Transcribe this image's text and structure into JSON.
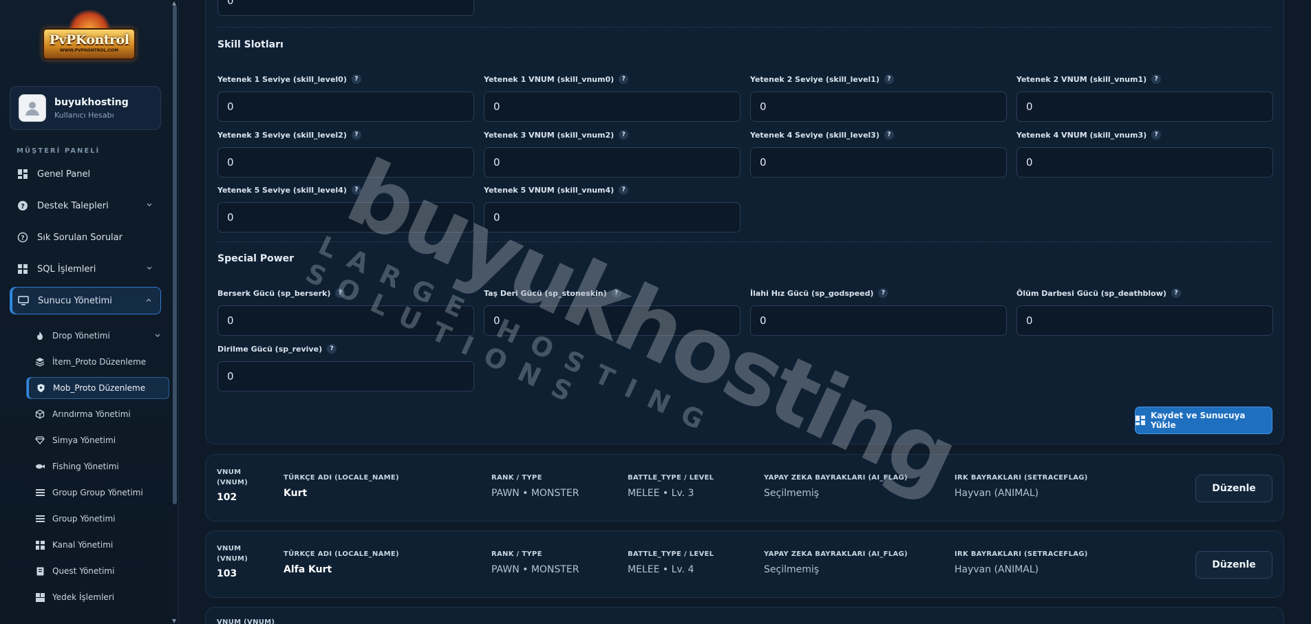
{
  "sidebar": {
    "logo_main": "PvPKontrol",
    "logo_sub": "WWW.PVPKONTROL.COM",
    "user": {
      "name": "buyukhosting",
      "role": "Kullanıcı Hesabı"
    },
    "section_title": "MÜŞTERİ PANELİ",
    "items": [
      {
        "label": "Genel Panel",
        "icon": "dashboard-icon"
      },
      {
        "label": "Destek Talepleri",
        "icon": "help-circle-icon"
      },
      {
        "label": "Sık Sorulan Sorular",
        "icon": "question-circle-icon"
      },
      {
        "label": "SQL İşlemleri",
        "icon": "grid-icon"
      },
      {
        "label": "Sunucu Yönetimi",
        "icon": "monitor-icon"
      }
    ],
    "sub_items": [
      {
        "label": "Drop Yönetimi",
        "icon": "flame-icon"
      },
      {
        "label": "İtem_Proto Düzenleme",
        "icon": "layers-icon"
      },
      {
        "label": "Mob_Proto Düzenleme",
        "icon": "shield-icon"
      },
      {
        "label": "Arındırma Yönetimi",
        "icon": "cube-icon"
      },
      {
        "label": "Simya Yönetimi",
        "icon": "gem-icon"
      },
      {
        "label": "Fishing Yönetimi",
        "icon": "fish-icon"
      },
      {
        "label": "Group Group Yönetimi",
        "icon": "list-icon"
      },
      {
        "label": "Group Yönetimi",
        "icon": "list-icon"
      },
      {
        "label": "Kanal Yönetimi",
        "icon": "grid-icon"
      },
      {
        "label": "Quest Yönetimi",
        "icon": "book-icon"
      },
      {
        "label": "Yedek İşlemleri",
        "icon": "grid-icon"
      }
    ]
  },
  "form": {
    "top_value": "0",
    "skill_title": "Skill Slotları",
    "skill_fields": [
      {
        "label": "Yetenek 1 Seviye (skill_level0)",
        "value": "0"
      },
      {
        "label": "Yetenek 1 VNUM (skill_vnum0)",
        "value": "0"
      },
      {
        "label": "Yetenek 2 Seviye (skill_level1)",
        "value": "0"
      },
      {
        "label": "Yetenek 2 VNUM (skill_vnum1)",
        "value": "0"
      },
      {
        "label": "Yetenek 3 Seviye (skill_level2)",
        "value": "0"
      },
      {
        "label": "Yetenek 3 VNUM (skill_vnum2)",
        "value": "0"
      },
      {
        "label": "Yetenek 4 Seviye (skill_level3)",
        "value": "0"
      },
      {
        "label": "Yetenek 4 VNUM (skill_vnum3)",
        "value": "0"
      },
      {
        "label": "Yetenek 5 Seviye (skill_level4)",
        "value": "0"
      },
      {
        "label": "Yetenek 5 VNUM (skill_vnum4)",
        "value": "0"
      }
    ],
    "sp_title": "Special Power",
    "sp_fields": [
      {
        "label": "Berserk Gücü (sp_berserk)",
        "value": "0"
      },
      {
        "label": "Taş Deri Gücü (sp_stoneskin)",
        "value": "0"
      },
      {
        "label": "İlahi Hız Gücü (sp_godspeed)",
        "value": "0"
      },
      {
        "label": "Ölüm Darbesi Gücü (sp_deathblow)",
        "value": "0"
      },
      {
        "label": "Dirilme Gücü (sp_revive)",
        "value": "0"
      }
    ],
    "save_label": "Kaydet ve Sunucuya Yükle"
  },
  "mob_headers": {
    "vnum": "VNUM (VNUM)",
    "name": "TÜRKÇE ADI (LOCALE_NAME)",
    "rank": "RANK / TYPE",
    "battle": "BATTLE_TYPE / LEVEL",
    "ai": "YAPAY ZEKA BAYRAKLARI (AI_FLAG)",
    "race": "IRK BAYRAKLARI (SETRACEFLAG)"
  },
  "mobs": [
    {
      "vnum": "102",
      "name": "Kurt",
      "rank": "PAWN • MONSTER",
      "battle": "MELEE • Lv. 3",
      "ai": "Seçilmemiş",
      "race": "Hayvan (ANIMAL)"
    },
    {
      "vnum": "103",
      "name": "Alfa Kurt",
      "rank": "PAWN • MONSTER",
      "battle": "MELEE • Lv. 4",
      "ai": "Seçilmemiş",
      "race": "Hayvan (ANIMAL)"
    }
  ],
  "edit_label": "Düzenle",
  "watermark": {
    "main": "buyukhosting",
    "sub": "LARGE HOSTING SOLUTIONS"
  }
}
